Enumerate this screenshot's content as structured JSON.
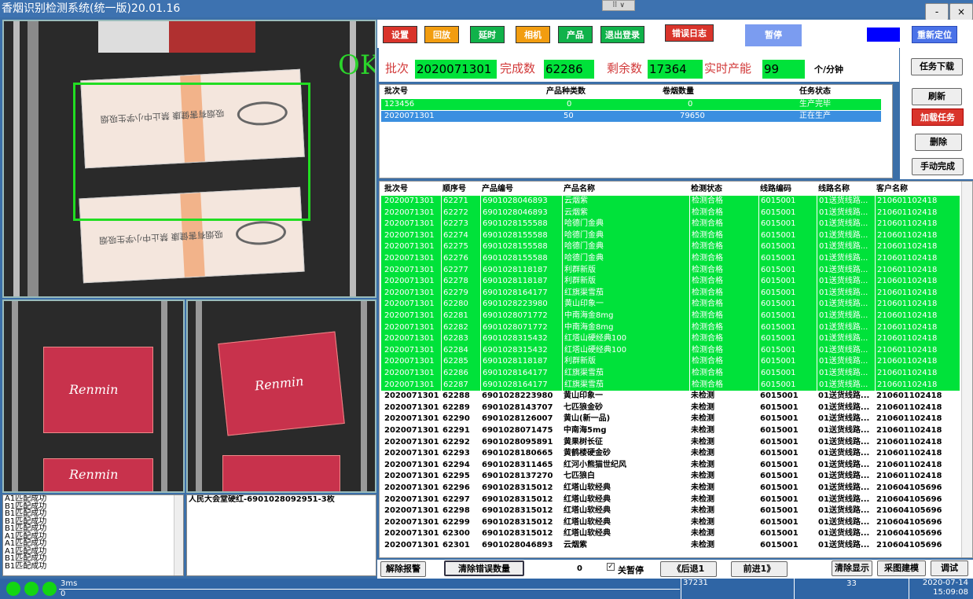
{
  "window": {
    "title": "香烟识别检测系统(统一版)20.01.16",
    "minimize": "-",
    "close": "×",
    "sys_menu": "⠿ ∨"
  },
  "camera": {
    "ok_label": "OK",
    "pack_text": "吸烟有害健康 禁止中小学生吸烟",
    "brand_text": "Renmin"
  },
  "log": {
    "lines": [
      "A1匹配成功",
      "B1匹配成功",
      "B1匹配成功",
      "B1匹配成功",
      "B1匹配成功",
      "A1匹配成功",
      "A1匹配成功",
      "A1匹配成功",
      "B1匹配成功",
      "B1匹配成功"
    ],
    "result": "人民大会堂硬红-6901028092951-3枚"
  },
  "controls": {
    "settings": "设置",
    "recycle": "回放",
    "delay": "延时",
    "camera": "相机",
    "product": "产品",
    "logout": "退出登录",
    "error_log": "错误日志",
    "pause": "暂停",
    "relocate": "重新定位",
    "download_task": "任务下载",
    "refresh": "刷新",
    "load_task": "加载任务",
    "delete": "删除",
    "manual_complete": "手动完成"
  },
  "colors": {
    "red_btn": "#d9342b",
    "orange_btn": "#f29d10",
    "green_btn": "#10b24a",
    "pause_btn": "#7b9cf0",
    "relocate_btn": "#4a72e8",
    "indicator": "#0000ff",
    "ok_row": "#00e23a",
    "active_row": "#3a8fe0"
  },
  "stats": {
    "batch_label": "批次",
    "batch_value": "2020071301",
    "done_label": "完成数",
    "done_value": "62286",
    "remain_label": "剩余数",
    "remain_value": "17364",
    "rate_label": "实时产能",
    "rate_value": "99",
    "rate_unit": "个/分钟"
  },
  "task_table": {
    "headers": [
      "批次号",
      "产品种类数",
      "卷烟数量",
      "任务状态"
    ],
    "rows": [
      {
        "batch": "123456",
        "kinds": "0",
        "qty": "0",
        "status": "生产完毕"
      },
      {
        "batch": "2020071301",
        "kinds": "50",
        "qty": "79650",
        "status": "正在生产"
      }
    ]
  },
  "detail_table": {
    "headers": [
      "批次号",
      "顺序号",
      "产品编号",
      "产品名称",
      "检测状态",
      "线路编码",
      "线路名称",
      "客户名称"
    ],
    "rows": [
      [
        "2020071301",
        "62271",
        "6901028046893",
        "云烟紫",
        "检测合格",
        "6015001",
        "01送货线路...",
        "210601102418"
      ],
      [
        "2020071301",
        "62272",
        "6901028046893",
        "云烟紫",
        "检测合格",
        "6015001",
        "01送货线路...",
        "210601102418"
      ],
      [
        "2020071301",
        "62273",
        "6901028155588",
        "哈德门金典",
        "检测合格",
        "6015001",
        "01送货线路...",
        "210601102418"
      ],
      [
        "2020071301",
        "62274",
        "6901028155588",
        "哈德门金典",
        "检测合格",
        "6015001",
        "01送货线路...",
        "210601102418"
      ],
      [
        "2020071301",
        "62275",
        "6901028155588",
        "哈德门金典",
        "检测合格",
        "6015001",
        "01送货线路...",
        "210601102418"
      ],
      [
        "2020071301",
        "62276",
        "6901028155588",
        "哈德门金典",
        "检测合格",
        "6015001",
        "01送货线路...",
        "210601102418"
      ],
      [
        "2020071301",
        "62277",
        "6901028118187",
        "利群新版",
        "检测合格",
        "6015001",
        "01送货线路...",
        "210601102418"
      ],
      [
        "2020071301",
        "62278",
        "6901028118187",
        "利群新版",
        "检测合格",
        "6015001",
        "01送货线路...",
        "210601102418"
      ],
      [
        "2020071301",
        "62279",
        "6901028164177",
        "红旗渠雪茄",
        "检测合格",
        "6015001",
        "01送货线路...",
        "210601102418"
      ],
      [
        "2020071301",
        "62280",
        "6901028223980",
        "黄山印象一",
        "检测合格",
        "6015001",
        "01送货线路...",
        "210601102418"
      ],
      [
        "2020071301",
        "62281",
        "6901028071772",
        "中南海金8mg",
        "检测合格",
        "6015001",
        "01送货线路...",
        "210601102418"
      ],
      [
        "2020071301",
        "62282",
        "6901028071772",
        "中南海金8mg",
        "检测合格",
        "6015001",
        "01送货线路...",
        "210601102418"
      ],
      [
        "2020071301",
        "62283",
        "6901028315432",
        "红塔山硬经典100",
        "检测合格",
        "6015001",
        "01送货线路...",
        "210601102418"
      ],
      [
        "2020071301",
        "62284",
        "6901028315432",
        "红塔山硬经典100",
        "检测合格",
        "6015001",
        "01送货线路...",
        "210601102418"
      ],
      [
        "2020071301",
        "62285",
        "6901028118187",
        "利群新版",
        "检测合格",
        "6015001",
        "01送货线路...",
        "210601102418"
      ],
      [
        "2020071301",
        "62286",
        "6901028164177",
        "红旗渠雪茄",
        "检测合格",
        "6015001",
        "01送货线路...",
        "210601102418"
      ],
      [
        "2020071301",
        "62287",
        "6901028164177",
        "红旗渠雪茄",
        "检测合格",
        "6015001",
        "01送货线路...",
        "210601102418"
      ],
      [
        "2020071301",
        "62288",
        "6901028223980",
        "黄山印象一",
        "未检测",
        "6015001",
        "01送货线路...",
        "210601102418"
      ],
      [
        "2020071301",
        "62289",
        "6901028143707",
        "七匹狼金砂",
        "未检测",
        "6015001",
        "01送货线路...",
        "210601102418"
      ],
      [
        "2020071301",
        "62290",
        "6901028126007",
        "黄山(新一品)",
        "未检测",
        "6015001",
        "01送货线路...",
        "210601102418"
      ],
      [
        "2020071301",
        "62291",
        "6901028071475",
        "中南海5mg",
        "未检测",
        "6015001",
        "01送货线路...",
        "210601102418"
      ],
      [
        "2020071301",
        "62292",
        "6901028095891",
        "黄果树长征",
        "未检测",
        "6015001",
        "01送货线路...",
        "210601102418"
      ],
      [
        "2020071301",
        "62293",
        "6901028180665",
        "黄鹤楼硬金砂",
        "未检测",
        "6015001",
        "01送货线路...",
        "210601102418"
      ],
      [
        "2020071301",
        "62294",
        "6901028311465",
        "红河小熊猫世纪风",
        "未检测",
        "6015001",
        "01送货线路...",
        "210601102418"
      ],
      [
        "2020071301",
        "62295",
        "6901028137270",
        "七匹狼白",
        "未检测",
        "6015001",
        "01送货线路...",
        "210601102418"
      ],
      [
        "2020071301",
        "62296",
        "6901028315012",
        "红塔山软经典",
        "未检测",
        "6015001",
        "01送货线路...",
        "210604105696"
      ],
      [
        "2020071301",
        "62297",
        "6901028315012",
        "红塔山软经典",
        "未检测",
        "6015001",
        "01送货线路...",
        "210604105696"
      ],
      [
        "2020071301",
        "62298",
        "6901028315012",
        "红塔山软经典",
        "未检测",
        "6015001",
        "01送货线路...",
        "210604105696"
      ],
      [
        "2020071301",
        "62299",
        "6901028315012",
        "红塔山软经典",
        "未检测",
        "6015001",
        "01送货线路...",
        "210604105696"
      ],
      [
        "2020071301",
        "62300",
        "6901028315012",
        "红塔山软经典",
        "未检测",
        "6015001",
        "01送货线路...",
        "210604105696"
      ],
      [
        "2020071301",
        "62301",
        "6901028046893",
        "云烟紫",
        "未检测",
        "6015001",
        "01送货线路...",
        "210604105696"
      ]
    ],
    "ok_count": 17
  },
  "bottom": {
    "clear_alarm": "解除报警",
    "clear_errors": "清除错误数量",
    "error_count": "0",
    "pause_off_label": "关暂停",
    "back_one": "《后退1",
    "forward_one": "前进1》",
    "clear_display": "清除显示",
    "capture_model": "采图建模",
    "debug": "调试"
  },
  "status": {
    "time_ms": "3ms",
    "zero": "0",
    "count_a": "37231",
    "count_b": "33",
    "date": "2020-07-14",
    "time": "15:09:08"
  }
}
